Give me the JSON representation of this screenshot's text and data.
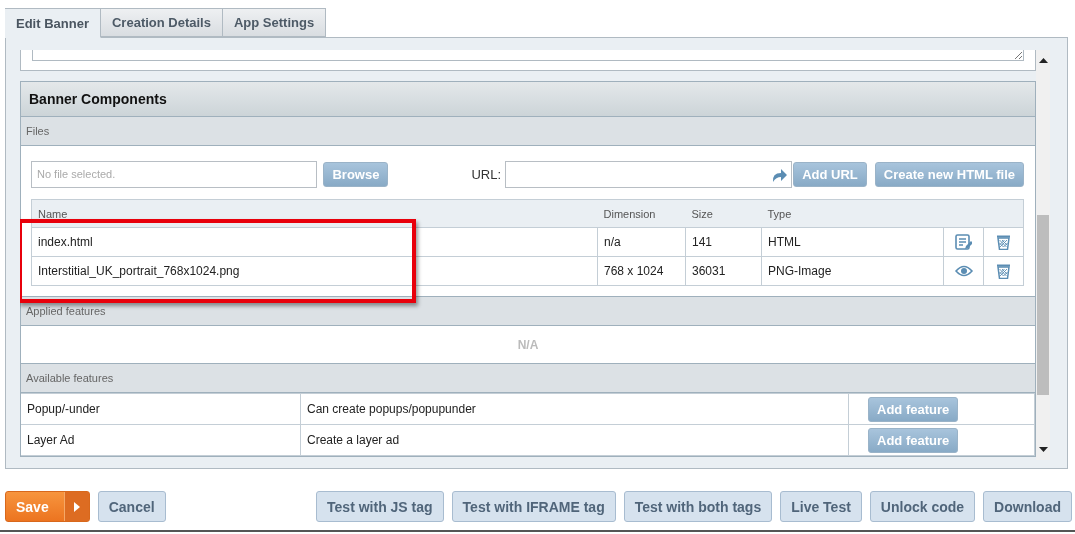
{
  "tabs": [
    {
      "label": "Edit Banner",
      "selected": true
    },
    {
      "label": "Creation Details",
      "selected": false
    },
    {
      "label": "App Settings",
      "selected": false
    }
  ],
  "section": {
    "title": "Banner Components"
  },
  "files": {
    "label": "Files",
    "file_field": {
      "placeholder": "No file selected."
    },
    "browse_button": "Browse",
    "url_label": "URL:",
    "add_url_button": "Add URL",
    "create_button": "Create new HTML file",
    "columns": [
      "Name",
      "Dimension",
      "Size",
      "Type"
    ],
    "rows": [
      {
        "name": "index.html",
        "dimension": "n/a",
        "size": "141",
        "type": "HTML",
        "highlighted": true,
        "actions": [
          {
            "kind": "edit"
          },
          {
            "kind": "delete"
          }
        ]
      },
      {
        "name": "Interstitial_UK_portrait_768x1024.png",
        "dimension": "768 x 1024",
        "size": "36031",
        "type": "PNG-Image",
        "highlighted": true,
        "actions": [
          {
            "kind": "view"
          },
          {
            "kind": "delete"
          }
        ]
      }
    ]
  },
  "applied_features": {
    "label": "Applied features",
    "empty_text": "N/A"
  },
  "available_features": {
    "label": "Available features",
    "rows": [
      {
        "name": "Popup/-under",
        "description": "Can create popups/popupunder",
        "button": "Add feature"
      },
      {
        "name": "Layer Ad",
        "description": "Create a layer ad",
        "button": "Add feature"
      }
    ]
  },
  "actions": [
    {
      "label": "Save",
      "kind": "primary"
    },
    {
      "label": "Cancel",
      "kind": "secondary"
    },
    {
      "label": "Test with JS tag",
      "kind": "secondary"
    },
    {
      "label": "Test with IFRAME tag",
      "kind": "secondary"
    },
    {
      "label": "Test with both tags",
      "kind": "secondary"
    },
    {
      "label": "Live Test",
      "kind": "secondary"
    },
    {
      "label": "Unlock code",
      "kind": "secondary"
    },
    {
      "label": "Download",
      "kind": "secondary"
    }
  ]
}
